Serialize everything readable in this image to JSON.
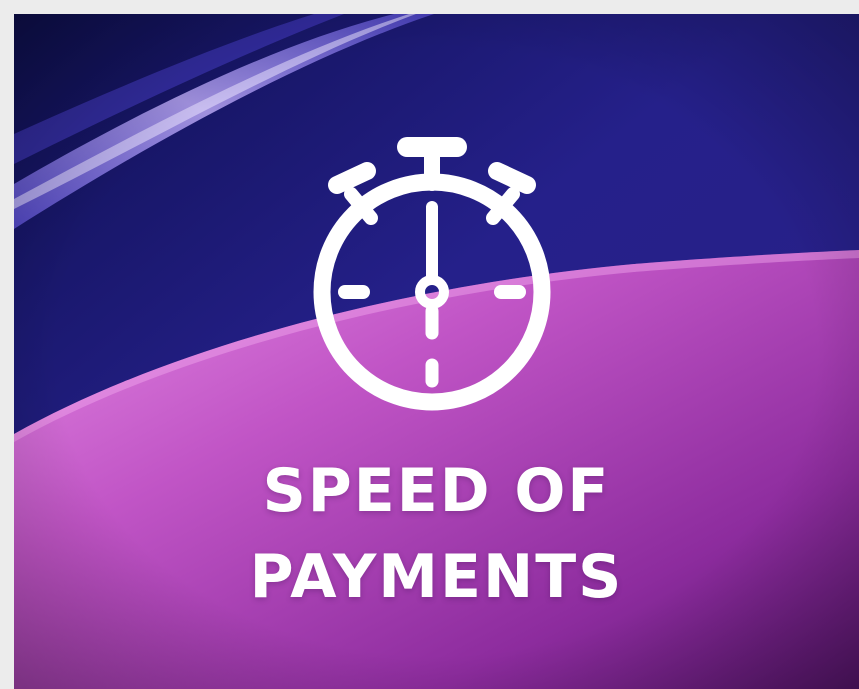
{
  "card": {
    "title_line1": "SPEED OF",
    "title_line2": "PAYMENTS",
    "icon": "stopwatch-icon"
  },
  "colors": {
    "page_background": "#ececec",
    "navy_top": "#1c1870",
    "magenta_wave": "#c657c8",
    "deep_purple": "#6a1a7c",
    "lavender_streak": "#a48ee6",
    "foreground": "#ffffff"
  }
}
